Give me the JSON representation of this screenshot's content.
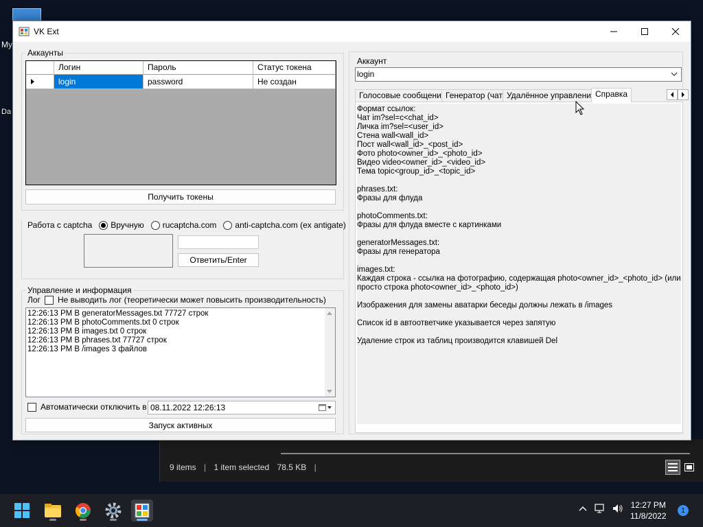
{
  "desktop": {
    "text1": "My",
    "text2": "Da"
  },
  "explorer": {
    "items_count": "9 items",
    "sep1": "|",
    "selected": "1 item selected",
    "size": "78.5 KB",
    "sep2": "|"
  },
  "window": {
    "title": "VK Ext"
  },
  "accounts": {
    "group_label": "Аккаунты",
    "columns": [
      "Логин",
      "Пароль",
      "Статус токена"
    ],
    "row": {
      "login": "login",
      "password": "password",
      "status": "Не создан"
    },
    "get_tokens_label": "Получить токены"
  },
  "captcha": {
    "label": "Работа с captcha",
    "options": [
      "Вручную",
      "rucaptcha.com",
      "anti-captcha.com (ex antigate)"
    ],
    "selected_index": 0,
    "answer_value": "",
    "submit_label": "Ответить/Enter"
  },
  "control": {
    "group_label": "Управление и информация",
    "log_label": "Лог",
    "no_log_label": "Не выводить лог (теоретически может повысить производительность)",
    "log_lines": [
      "12:26:13 PM В generatorMessages.txt 77727 строк",
      "12:26:13 PM В photoComments.txt 0 строк",
      "12:26:13 PM В images.txt 0 строк",
      "12:26:13 PM В phrases.txt 77727 строк",
      "12:26:13 PM В /images 3 файлов"
    ],
    "auto_off_label": "Автоматически отключить в",
    "auto_off_datetime": "08.11.2022 12:26:13",
    "run_label": "Запуск активных"
  },
  "right": {
    "account_label": "Аккаунт",
    "account_value": "login",
    "tabs": [
      "Голосовые сообщения",
      "Генератор (чат)",
      "Удалённое управление",
      "Справка"
    ],
    "active_tab": 3,
    "help_text": "Формат ссылок:\nЧат im?sel=c<chat_id>\nЛичка im?sel=<user_id>\nСтена wall<wall_id>\nПост wall<wall_id>_<post_id>\nФото photo<owner_id>_<photo_id>\nВидео video<owner_id>_<video_id>\nТема topic<group_id>_<topic_id>\n\nphrases.txt:\nФразы для флуда\n\nphotoComments.txt:\nФразы для флуда вместе с картинками\n\ngeneratorMessages.txt:\nФразы для генератора\n\nimages.txt:\nКаждая строка - ссылка на фотографию, содержащая photo<owner_id>_<photo_id> (или\nпросто строка photo<owner_id>_<photo_id>)\n\nИзображения для замены аватарки беседы должны лежать в /images\n\nСписок id в автоответчике указывается через запятую\n\nУдаление строк из таблиц производится клавишей Del"
  },
  "taskbar": {
    "time": "12:27 PM",
    "date": "11/8/2022",
    "notifications": "1"
  }
}
